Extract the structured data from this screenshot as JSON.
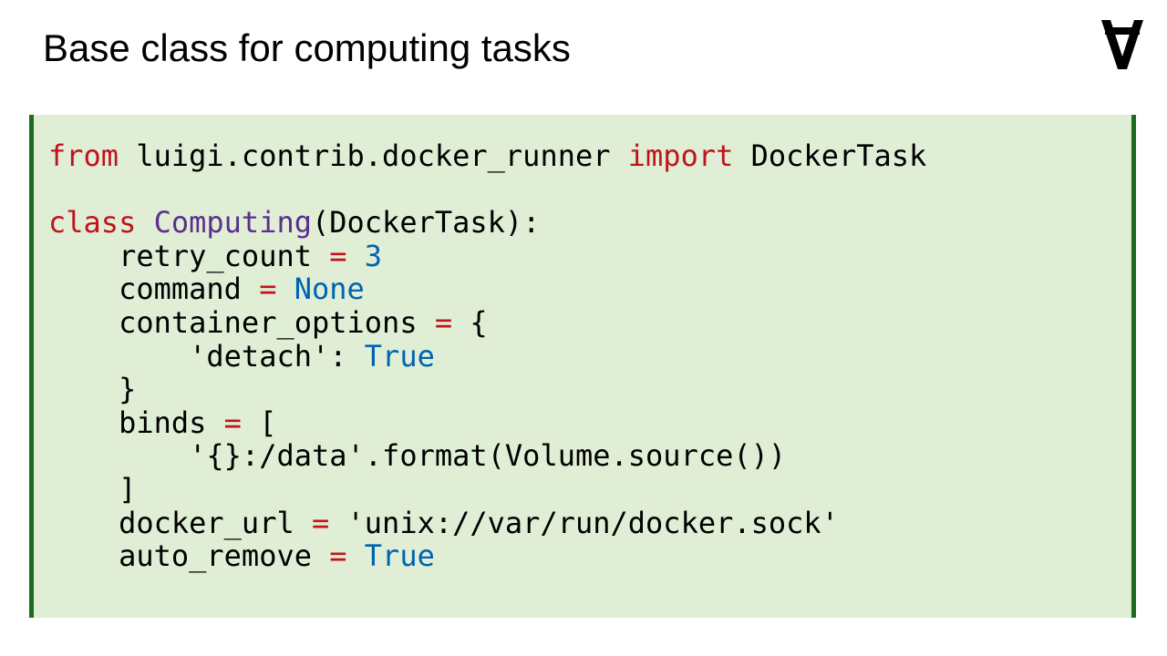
{
  "title": "Base class for computing tasks",
  "colors": {
    "panel_background": "#dfeed5",
    "panel_border": "#1f6b1f",
    "keyword": "#c0141c",
    "class_name": "#5b2f8c",
    "constant": "#0063b1"
  },
  "logo": {
    "icon": "inverted-a-logo-icon"
  },
  "code": {
    "lines": [
      [
        {
          "t": "from",
          "k": "kw"
        },
        {
          "t": " luigi.contrib.docker_runner "
        },
        {
          "t": "import",
          "k": "kw"
        },
        {
          "t": " DockerTask"
        }
      ],
      [],
      [
        {
          "t": "class",
          "k": "kw"
        },
        {
          "t": " "
        },
        {
          "t": "Computing",
          "k": "cls"
        },
        {
          "t": "(DockerTask):"
        }
      ],
      [
        {
          "t": "    retry_count "
        },
        {
          "t": "=",
          "k": "op"
        },
        {
          "t": " "
        },
        {
          "t": "3",
          "k": "num"
        }
      ],
      [
        {
          "t": "    command "
        },
        {
          "t": "=",
          "k": "op"
        },
        {
          "t": " "
        },
        {
          "t": "None",
          "k": "num"
        }
      ],
      [
        {
          "t": "    container_options "
        },
        {
          "t": "=",
          "k": "op"
        },
        {
          "t": " {"
        }
      ],
      [
        {
          "t": "        'detach': "
        },
        {
          "t": "True",
          "k": "num"
        }
      ],
      [
        {
          "t": "    }"
        }
      ],
      [
        {
          "t": "    binds "
        },
        {
          "t": "=",
          "k": "op"
        },
        {
          "t": " ["
        }
      ],
      [
        {
          "t": "        '{}:/data'.format(Volume.source())"
        }
      ],
      [
        {
          "t": "    ]"
        }
      ],
      [
        {
          "t": "    docker_url "
        },
        {
          "t": "=",
          "k": "op"
        },
        {
          "t": " 'unix://var/run/docker.sock'"
        }
      ],
      [
        {
          "t": "    auto_remove "
        },
        {
          "t": "=",
          "k": "op"
        },
        {
          "t": " "
        },
        {
          "t": "True",
          "k": "num"
        }
      ]
    ]
  }
}
